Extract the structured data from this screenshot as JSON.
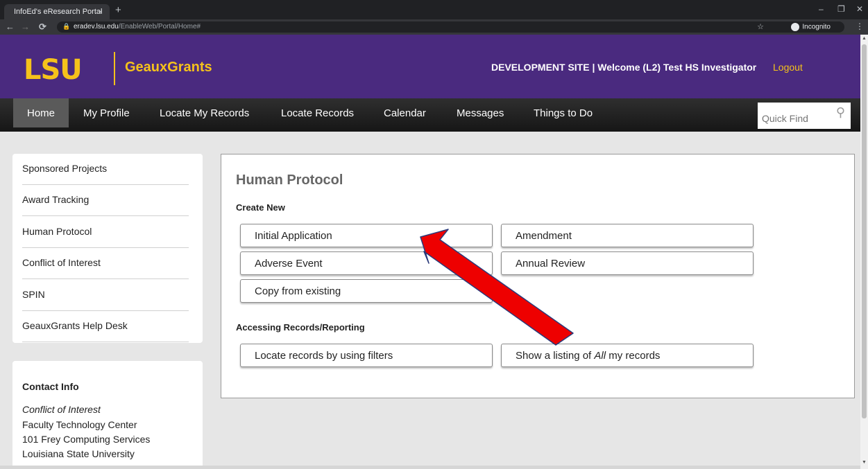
{
  "browser": {
    "tab_title": "InfoEd's eResearch Portal",
    "tab_close": "×",
    "new_tab": "+",
    "url_domain": "eradev.lsu.edu",
    "url_path": "/EnableWeb/Portal/Home#",
    "incognito_label": "Incognito",
    "window_controls": [
      "–",
      "❐",
      "✕"
    ]
  },
  "header": {
    "logo_text": "LSU",
    "brand": "GeauxGrants",
    "welcome": "DEVELOPMENT SITE | Welcome (L2) Test HS Investigator",
    "logout": "Logout"
  },
  "nav": {
    "items": [
      "Home",
      "My Profile",
      "Locate My Records",
      "Locate Records",
      "Calendar",
      "Messages",
      "Things to Do"
    ],
    "active": "Home",
    "quick_find_placeholder": "Quick Find"
  },
  "sidebar": {
    "items": [
      "Sponsored Projects",
      "Award Tracking",
      "Human Protocol",
      "Conflict of Interest",
      "SPIN",
      "GeauxGrants Help Desk"
    ]
  },
  "contact": {
    "title": "Contact Info",
    "lines": [
      "Conflict of Interest",
      "Faculty Technology Center",
      "101 Frey Computing Services",
      "Louisiana State University"
    ]
  },
  "main": {
    "title": "Human Protocol",
    "create_label": "Create New",
    "create_buttons": [
      "Initial Application",
      "Amendment",
      "Adverse Event",
      "Annual Review",
      "Copy from existing"
    ],
    "access_label": "Accessing Records/Reporting",
    "filter_button": "Locate records by using filters",
    "listing_prefix": "Show a listing of ",
    "listing_emphasis": "All",
    "listing_suffix": " my records"
  },
  "colors": {
    "lsu_purple": "#4a2a7f",
    "lsu_gold": "#f5c21b",
    "annotation_arrow": "#ee0000"
  }
}
